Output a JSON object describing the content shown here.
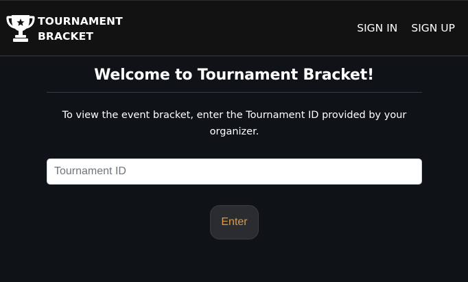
{
  "navbar": {
    "brand": {
      "icon": "trophy-icon",
      "line1": "TOURNAMENT",
      "line2": "BRACKET"
    },
    "links": {
      "sign_in": "SIGN IN",
      "sign_up": "SIGN UP"
    }
  },
  "main": {
    "title": "Welcome to Tournament Bracket!",
    "description": "To view the event bracket, enter the Tournament ID provided by your organizer.",
    "tournament_input": {
      "placeholder": "Tournament ID",
      "value": ""
    },
    "enter_label": "Enter"
  },
  "colors": {
    "page_background": "#0f1318",
    "navbar_background": "#121212",
    "button_background": "#2a2c30",
    "button_text": "#d99a4e"
  }
}
